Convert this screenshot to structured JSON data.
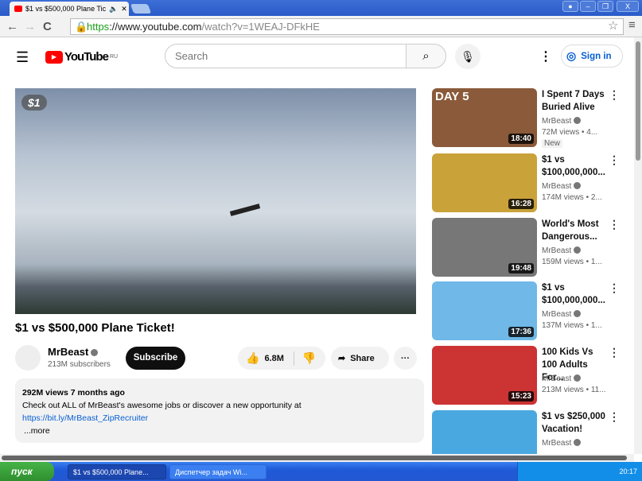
{
  "browser": {
    "tab_title": "$1 vs $500,000 Plane Tic",
    "url_scheme": "https",
    "url_host": "://www.youtube.com",
    "url_path": "/watch?v=1WEAJ-DFkHE"
  },
  "header": {
    "logo": "YouTube",
    "region": "RU",
    "search_placeholder": "Search",
    "sign_in": "Sign in"
  },
  "video": {
    "badge": "$1",
    "title": "$1 vs $500,000 Plane Ticket!",
    "channel": "MrBeast",
    "subscribers": "213M subscribers",
    "subscribe": "Subscribe",
    "likes": "6.8M",
    "share": "Share",
    "views_date": "292M views  7 months ago",
    "description": "Check out ALL of MrBeast's awesome jobs or discover a new opportunity at",
    "link": "https://bit.ly/MrBeast_ZipRecruiter",
    "more": "...more"
  },
  "sidebar": [
    {
      "title": "I Spent 7 Days Buried Alive",
      "channel": "MrBeast",
      "views": "72M views  • 4...",
      "badge": "New",
      "duration": "18:40",
      "overlay": "DAY 5",
      "color": "#8a5a3a"
    },
    {
      "title": "$1 vs $100,000,000...",
      "channel": "MrBeast",
      "views": "174M views  • 2...",
      "duration": "16:28",
      "color": "#c9a23a"
    },
    {
      "title": "World's Most Dangerous...",
      "channel": "MrBeast",
      "views": "159M views  • 1...",
      "duration": "19:48",
      "color": "#777"
    },
    {
      "title": "$1 vs $100,000,000...",
      "channel": "MrBeast",
      "views": "137M views  • 1...",
      "duration": "17:36",
      "color": "#6fb8e8"
    },
    {
      "title": "100 Kids Vs 100 Adults For...",
      "channel": "MrBeast",
      "views": "213M views  • 11...",
      "duration": "15:23",
      "color": "#c33"
    },
    {
      "title": "$1 vs $250,000 Vacation!",
      "channel": "MrBeast",
      "views": "",
      "duration": "",
      "color": "#4aa8e0"
    }
  ],
  "taskbar": {
    "start": "пуск",
    "items": [
      "$1 vs $500,000 Plane...",
      "Диспетчер задач Wi..."
    ],
    "clock": "20:17"
  }
}
